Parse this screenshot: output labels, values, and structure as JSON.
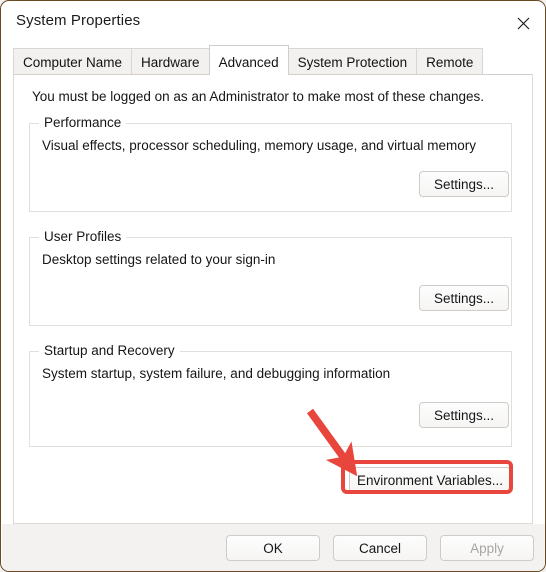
{
  "window": {
    "title": "System Properties",
    "close_icon": "close-icon",
    "accent_annotation_color": "#e8453c"
  },
  "tabs": [
    {
      "label": "Computer Name",
      "selected": false
    },
    {
      "label": "Hardware",
      "selected": false
    },
    {
      "label": "Advanced",
      "selected": true
    },
    {
      "label": "System Protection",
      "selected": false
    },
    {
      "label": "Remote",
      "selected": false
    }
  ],
  "content": {
    "admin_note": "You must be logged on as an Administrator to make most of these changes.",
    "groups": [
      {
        "title": "Performance",
        "description": "Visual effects, processor scheduling, memory usage, and virtual memory",
        "button_label": "Settings..."
      },
      {
        "title": "User Profiles",
        "description": "Desktop settings related to your sign-in",
        "button_label": "Settings..."
      },
      {
        "title": "Startup and Recovery",
        "description": "System startup, system failure, and debugging information",
        "button_label": "Settings..."
      }
    ],
    "environment_variables_button": "Environment Variables..."
  },
  "footer": {
    "ok_label": "OK",
    "cancel_label": "Cancel",
    "apply_label": "Apply",
    "apply_disabled": true
  }
}
